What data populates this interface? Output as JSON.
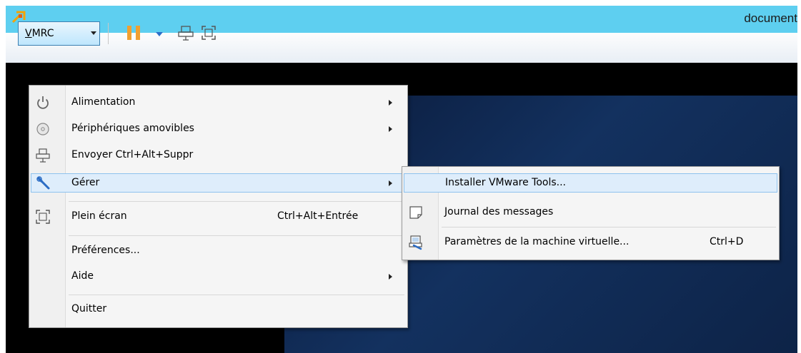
{
  "window": {
    "title": "document"
  },
  "toolbar": {
    "vmrc_prefix": "V",
    "vmrc_rest": "MRC",
    "icons": [
      "pause-icon",
      "dropdown-caret-icon",
      "send-ctrl-alt-del-icon",
      "fullscreen-icon"
    ]
  },
  "vmrc_menu": {
    "items": [
      {
        "label": "Alimentation",
        "icon": "power-icon",
        "submenu": true
      },
      {
        "label": "Périphériques amovibles",
        "icon": "disc-icon",
        "submenu": true
      },
      {
        "label": "Envoyer Ctrl+Alt+Suppr",
        "icon": "keyboard-network-icon",
        "submenu": false
      },
      {
        "label": "Gérer",
        "icon": "wrench-icon",
        "submenu": true,
        "highlighted": true
      },
      {
        "label": "Plein écran",
        "icon": "fullscreen-icon",
        "shortcut": "Ctrl+Alt+Entrée"
      },
      {
        "label": "Préférences..."
      },
      {
        "label": "Aide",
        "submenu": true
      },
      {
        "label": "Quitter"
      }
    ]
  },
  "manage_submenu": {
    "items": [
      {
        "label": "Installer VMware Tools...",
        "highlighted": true
      },
      {
        "label": "Journal des messages",
        "icon": "log-note-icon"
      },
      {
        "label": "Paramètres de la machine virtuelle...",
        "icon": "vm-settings-icon",
        "shortcut": "Ctrl+D"
      }
    ]
  },
  "colors": {
    "titlebar": "#5ecff0",
    "accent_pause": "#f0a031",
    "highlight": "#deedfb",
    "highlight_border": "#8ec2ee"
  }
}
